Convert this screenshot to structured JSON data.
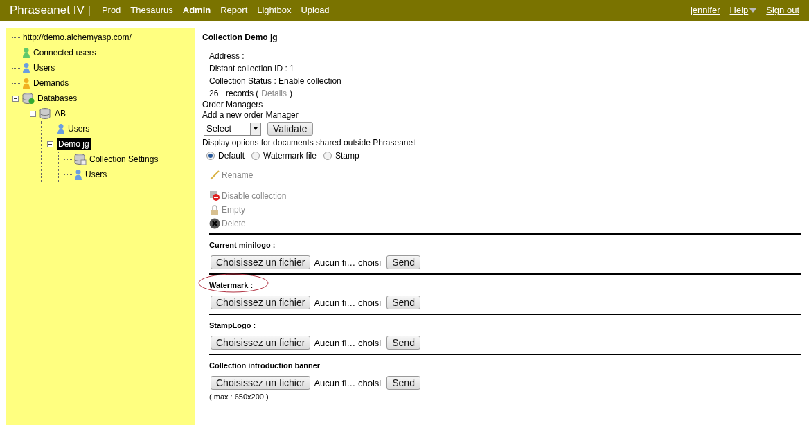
{
  "topbar": {
    "brand": "Phraseanet IV |",
    "nav": [
      {
        "label": "Prod",
        "selected": false
      },
      {
        "label": "Thesaurus",
        "selected": false
      },
      {
        "label": "Admin",
        "selected": true
      },
      {
        "label": "Report",
        "selected": false
      },
      {
        "label": "Lightbox",
        "selected": false
      },
      {
        "label": "Upload",
        "selected": false
      }
    ],
    "user": "jennifer",
    "help": "Help",
    "signout": "Sign out"
  },
  "tree": [
    {
      "label": "http://demo.alchemyasp.com/",
      "kind": "root",
      "selected": false
    },
    {
      "label": "Connected users",
      "kind": "user-green",
      "selected": false
    },
    {
      "label": "Users",
      "kind": "user-blue",
      "selected": false
    },
    {
      "label": "Demands",
      "kind": "user-orange",
      "selected": false
    },
    {
      "label": "Databases",
      "kind": "databases",
      "selected": false,
      "expanded": true,
      "children": [
        {
          "label": "AB",
          "kind": "database",
          "selected": false,
          "expanded": true,
          "children": [
            {
              "label": "Users",
              "kind": "user-blue",
              "selected": false
            },
            {
              "label": "Demo jg",
              "kind": "collection",
              "selected": true,
              "expanded": true,
              "children": [
                {
                  "label": "Collection Settings",
                  "kind": "settings",
                  "selected": false
                },
                {
                  "label": "Users",
                  "kind": "user-blue",
                  "selected": false
                }
              ]
            }
          ]
        }
      ]
    }
  ],
  "main": {
    "title": "Collection Demo jg",
    "info": [
      "Address :",
      "Distant collection ID : 1",
      "Collection Status : Enable collection"
    ],
    "records": {
      "count": "26",
      "label": "records (",
      "link": "Details",
      "close": ")"
    },
    "order_managers": "Order Managers",
    "add_manager": "Add a new order Manager",
    "select": "Select",
    "validate": "Validate",
    "display_options": "Display options for documents shared outside Phraseanet",
    "radios": [
      {
        "label": "Default",
        "selected": true
      },
      {
        "label": "Watermark file",
        "selected": false
      },
      {
        "label": "Stamp",
        "selected": false
      }
    ],
    "actions": [
      {
        "label": "Rename",
        "kind": "pencil"
      },
      {
        "label": "Disable collection",
        "kind": "disable"
      },
      {
        "label": "Empty",
        "kind": "lock"
      },
      {
        "label": "Delete",
        "kind": "delete"
      }
    ],
    "uploads": [
      {
        "title": "Current minilogo :",
        "annotated": false,
        "choose": "Choisissez un fichier",
        "status": "Aucun fi… choisi",
        "send": "Send"
      },
      {
        "title": "Watermark :",
        "annotated": true,
        "choose": "Choisissez un fichier",
        "status": "Aucun fi… choisi",
        "send": "Send"
      },
      {
        "title": "StampLogo :",
        "annotated": false,
        "choose": "Choisissez un fichier",
        "status": "Aucun fi… choisi",
        "send": "Send"
      },
      {
        "title": "Collection introduction banner",
        "annotated": false,
        "choose": "Choisissez un fichier",
        "status": "Aucun fi… choisi",
        "send": "Send",
        "note": "( max : 650x200 )"
      }
    ]
  }
}
